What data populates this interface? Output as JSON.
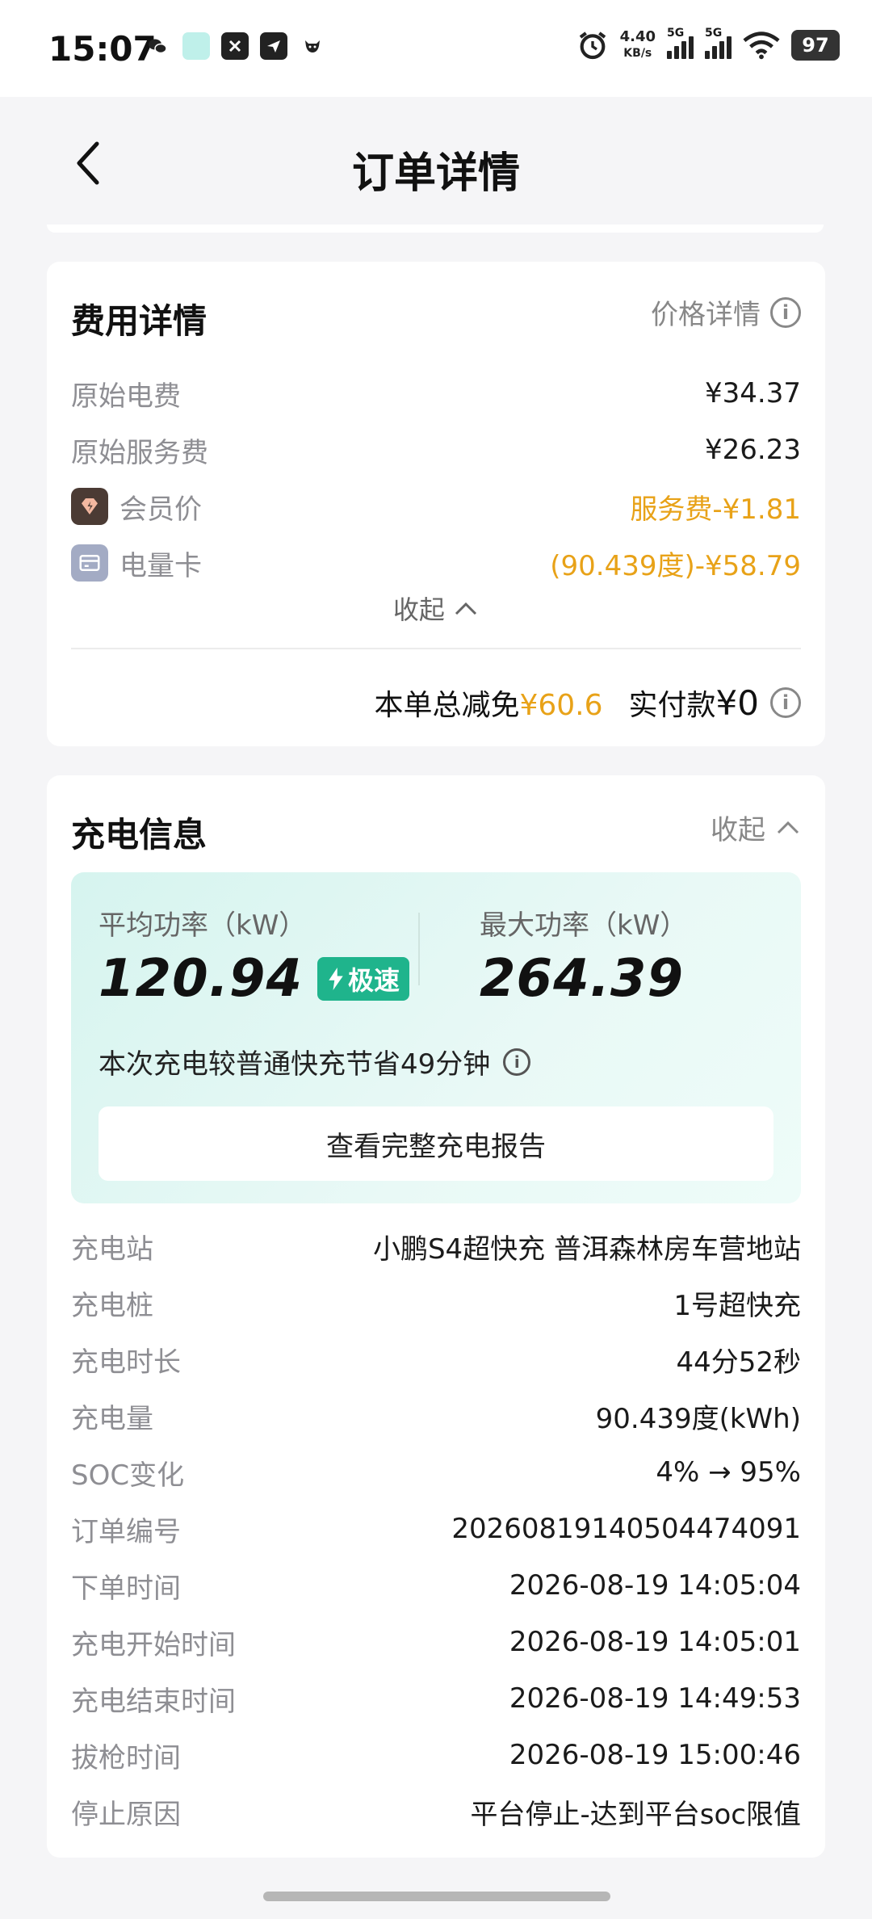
{
  "status_bar": {
    "time": "15:07",
    "net_speed_value": "4.40",
    "net_speed_unit": "KB/s",
    "network_tag_1": "5G",
    "network_tag_2": "5G",
    "battery": "97",
    "icons": [
      "wechat-icon",
      "app-icon",
      "x-app-icon",
      "send-icon",
      "bull-icon",
      "alarm-icon",
      "wifi-icon"
    ]
  },
  "header": {
    "title": "订单详情"
  },
  "fee_card": {
    "title": "费用详情",
    "price_detail_label": "价格详情",
    "rows": [
      {
        "label": "原始电费",
        "value": "¥34.37"
      },
      {
        "label": "原始服务费",
        "value": "¥26.23"
      }
    ],
    "member": {
      "label": "会员价",
      "value": "服务费-¥1.81"
    },
    "energy_card": {
      "label": "电量卡",
      "value": "(90.439度)-¥58.79"
    },
    "collapse_label": "收起",
    "total_discount_label": "本单总减免",
    "total_discount_value": "¥60.6",
    "paid_label": "实付款",
    "paid_value": "¥0",
    "accent_color": "#e8a218"
  },
  "charge_card": {
    "title": "充电信息",
    "collapse_label": "收起",
    "avg_power_label": "平均功率（kW）",
    "avg_power_value": "120.94",
    "speed_badge": "极速",
    "max_power_label": "最大功率（kW）",
    "max_power_value": "264.39",
    "save_note": "本次充电较普通快充节省49分钟",
    "report_button": "查看完整充电报告",
    "badge_color": "#1fb48c",
    "rows": [
      {
        "label": "充电站",
        "value": "小鹏S4超快充 普洱森林房车营地站"
      },
      {
        "label": "充电桩",
        "value": "1号超快充"
      },
      {
        "label": "充电时长",
        "value": "44分52秒"
      },
      {
        "label": "充电量",
        "value": "90.439度(kWh)"
      },
      {
        "label": "SOC变化",
        "value": "4% → 95%"
      },
      {
        "label": "订单编号",
        "value": "20260819140504474091"
      },
      {
        "label": "下单时间",
        "value": "2026-08-19 14:05:04"
      },
      {
        "label": "充电开始时间",
        "value": "2026-08-19 14:05:01"
      },
      {
        "label": "充电结束时间",
        "value": "2026-08-19 14:49:53"
      },
      {
        "label": "拔枪时间",
        "value": "2026-08-19 15:00:46"
      },
      {
        "label": "停止原因",
        "value": "平台停止-达到平台soc限值"
      }
    ]
  }
}
